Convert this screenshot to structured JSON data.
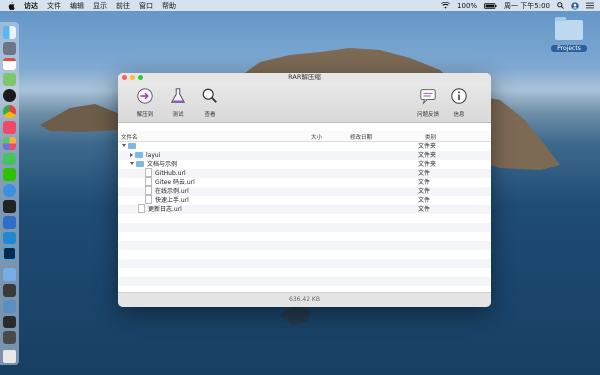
{
  "menubar": {
    "app": "访达",
    "items": [
      "文件",
      "编辑",
      "显示",
      "前往",
      "窗口",
      "帮助"
    ],
    "battery": "100%",
    "clock": "周一 下午5:00"
  },
  "desktop": {
    "folder_label": "Projects"
  },
  "window": {
    "title": "RAR解压缩",
    "toolbar": {
      "extract_to": "解压到",
      "test": "测试",
      "view": "查看",
      "feedback": "问题反馈",
      "info": "信息"
    },
    "columns": {
      "name": "文件名",
      "size": "大小",
      "modified": "修改日期",
      "kind": "类别"
    },
    "rows": [
      {
        "name": "",
        "kind": "文件夹"
      },
      {
        "name": "layui",
        "kind": "文件夹"
      },
      {
        "name": "文档与示例",
        "kind": "文件夹"
      },
      {
        "name": "GitHub.url",
        "kind": "文件"
      },
      {
        "name": "Gitee 码云.url",
        "kind": "文件"
      },
      {
        "name": "在线示例.url",
        "kind": "文件"
      },
      {
        "name": "快速上手.url",
        "kind": "文件"
      },
      {
        "name": "更新日志.url",
        "kind": "文件"
      }
    ],
    "status": "636.42 KB"
  },
  "colors": {
    "folder": "#7fb7e6",
    "close": "#ff5f57",
    "minimize": "#febc2e",
    "zoom": "#28c840"
  }
}
